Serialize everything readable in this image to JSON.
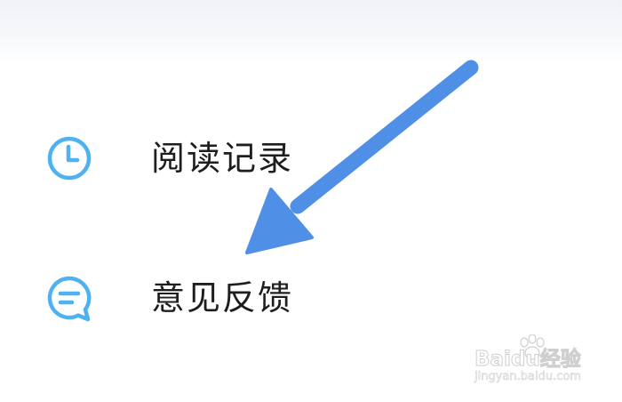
{
  "menu": {
    "items": [
      {
        "label": "阅读记录",
        "icon": "clock-icon"
      },
      {
        "label": "意见反馈",
        "icon": "chat-bubble-icon"
      }
    ]
  },
  "colors": {
    "icon_stroke": "#4fb2f0",
    "label_text": "#1e1e1e",
    "annotation_arrow": "#4f8fe6",
    "top_fade": "#eff2f6"
  },
  "watermark": {
    "brand": "Baidu经验",
    "url": "jingyan.baidu.com"
  }
}
